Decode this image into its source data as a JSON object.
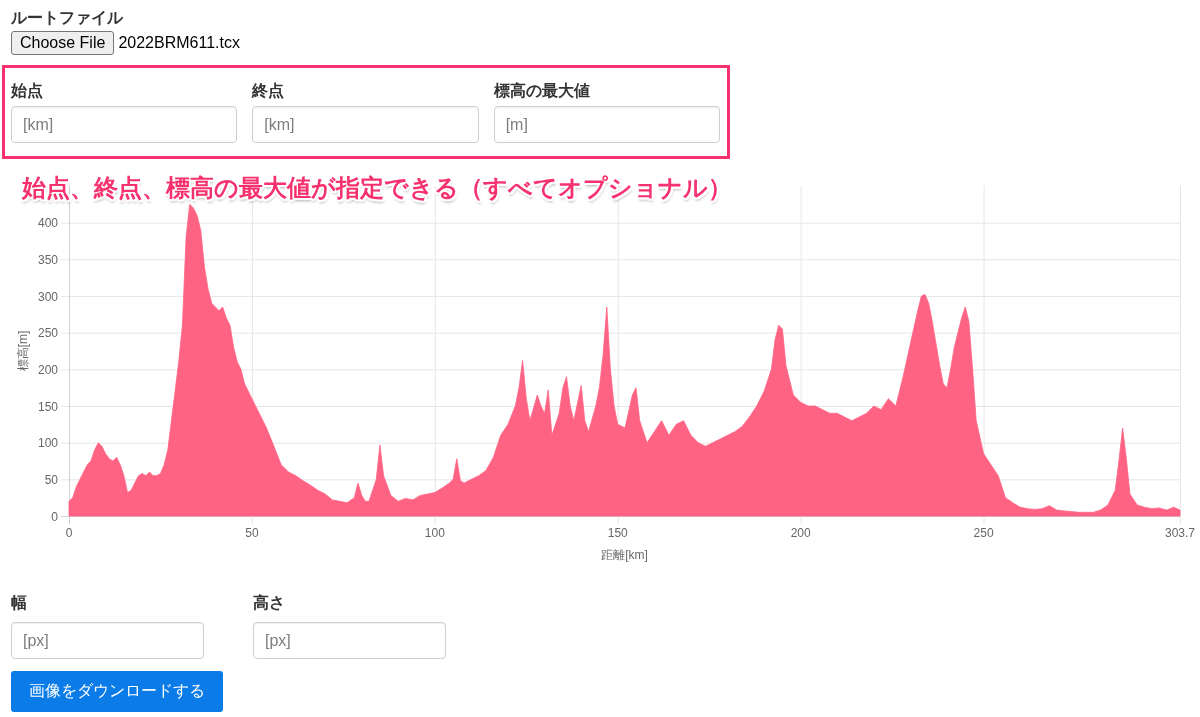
{
  "route_file": {
    "label": "ルートファイル",
    "button": "Choose File",
    "file_name": "2022BRM611.tcx"
  },
  "range_fields": [
    {
      "label": "始点",
      "placeholder": "[km]"
    },
    {
      "label": "終点",
      "placeholder": "[km]"
    },
    {
      "label": "標高の最大値",
      "placeholder": "[m]"
    }
  ],
  "annotation": "始点、終点、標高の最大値が指定できる（すべてオプショナル）",
  "chart": {
    "chart_data": {
      "type": "area",
      "xlabel": "距離[km]",
      "ylabel": "標高[m]",
      "grid": true,
      "x": [
        0,
        1,
        2,
        3,
        4,
        5,
        6,
        7,
        8,
        9,
        10,
        11,
        12,
        13,
        14,
        15,
        16,
        17,
        18,
        19,
        20,
        21,
        22,
        23,
        24,
        25,
        26,
        27,
        28,
        29,
        30,
        31,
        32,
        33,
        34,
        35,
        36,
        37,
        38,
        39,
        40,
        41,
        42,
        43,
        44,
        45,
        46,
        47,
        48,
        49,
        50,
        52,
        54,
        56,
        58,
        60,
        62,
        64,
        66,
        68,
        70,
        72,
        74,
        76,
        78,
        79,
        80,
        81,
        82,
        84,
        85,
        86,
        88,
        90,
        92,
        94,
        96,
        98,
        100,
        102,
        104,
        105,
        106,
        107,
        108,
        110,
        112,
        114,
        116,
        118,
        120,
        122,
        123,
        124,
        125,
        126,
        128,
        129,
        130,
        131,
        132,
        134,
        135,
        136,
        137,
        138,
        140,
        141,
        142,
        144,
        145,
        146,
        147,
        148,
        149,
        150,
        152,
        154,
        155,
        156,
        158,
        160,
        162,
        164,
        166,
        168,
        170,
        172,
        174,
        176,
        178,
        180,
        182,
        184,
        186,
        188,
        190,
        192,
        193,
        194,
        195,
        196,
        198,
        200,
        202,
        204,
        206,
        208,
        210,
        212,
        214,
        216,
        218,
        220,
        222,
        224,
        226,
        228,
        230,
        232,
        233,
        234,
        235,
        236,
        238,
        239,
        240,
        241,
        242,
        244,
        245,
        246,
        247,
        248,
        250,
        252,
        254,
        256,
        258,
        260,
        262,
        264,
        266,
        268,
        270,
        272,
        274,
        276,
        278,
        280,
        282,
        284,
        286,
        287,
        288,
        289,
        290,
        292,
        294,
        296,
        298,
        300,
        302,
        303.7
      ],
      "values": [
        20,
        25,
        40,
        50,
        60,
        70,
        75,
        90,
        100,
        95,
        85,
        78,
        75,
        80,
        70,
        55,
        32,
        35,
        45,
        55,
        58,
        55,
        60,
        55,
        55,
        58,
        70,
        90,
        130,
        170,
        210,
        260,
        380,
        425,
        420,
        410,
        390,
        340,
        310,
        290,
        285,
        280,
        285,
        270,
        260,
        230,
        210,
        200,
        180,
        170,
        160,
        140,
        120,
        95,
        70,
        60,
        55,
        48,
        42,
        35,
        30,
        22,
        20,
        18,
        25,
        45,
        28,
        20,
        20,
        50,
        97,
        55,
        28,
        20,
        24,
        22,
        28,
        30,
        32,
        38,
        45,
        50,
        78,
        48,
        45,
        50,
        55,
        62,
        80,
        110,
        125,
        150,
        175,
        212,
        160,
        130,
        165,
        150,
        140,
        172,
        110,
        140,
        175,
        190,
        150,
        130,
        178,
        130,
        115,
        150,
        175,
        220,
        285,
        200,
        150,
        125,
        120,
        165,
        175,
        130,
        100,
        115,
        130,
        110,
        125,
        130,
        110,
        100,
        95,
        100,
        105,
        110,
        115,
        122,
        135,
        150,
        170,
        200,
        240,
        260,
        255,
        205,
        165,
        155,
        150,
        150,
        145,
        140,
        140,
        135,
        130,
        135,
        140,
        150,
        145,
        160,
        150,
        190,
        235,
        280,
        300,
        302,
        290,
        265,
        205,
        180,
        175,
        200,
        230,
        270,
        285,
        265,
        200,
        130,
        85,
        70,
        55,
        25,
        18,
        12,
        10,
        9,
        10,
        14,
        8,
        7,
        6,
        5,
        5,
        5,
        8,
        15,
        35,
        75,
        120,
        80,
        30,
        15,
        12,
        10,
        11,
        8,
        12,
        8
      ],
      "xlim": [
        0,
        303.7
      ],
      "ylim": [
        0,
        450
      ],
      "xticks": [
        0,
        50,
        100,
        150,
        200,
        250,
        303.7
      ],
      "yticks": [
        0,
        50,
        100,
        150,
        200,
        250,
        300,
        350,
        400
      ]
    }
  },
  "size_fields": [
    {
      "label": "幅",
      "placeholder": "[px]"
    },
    {
      "label": "高さ",
      "placeholder": "[px]"
    }
  ],
  "download_button": "画像をダウンロードする"
}
